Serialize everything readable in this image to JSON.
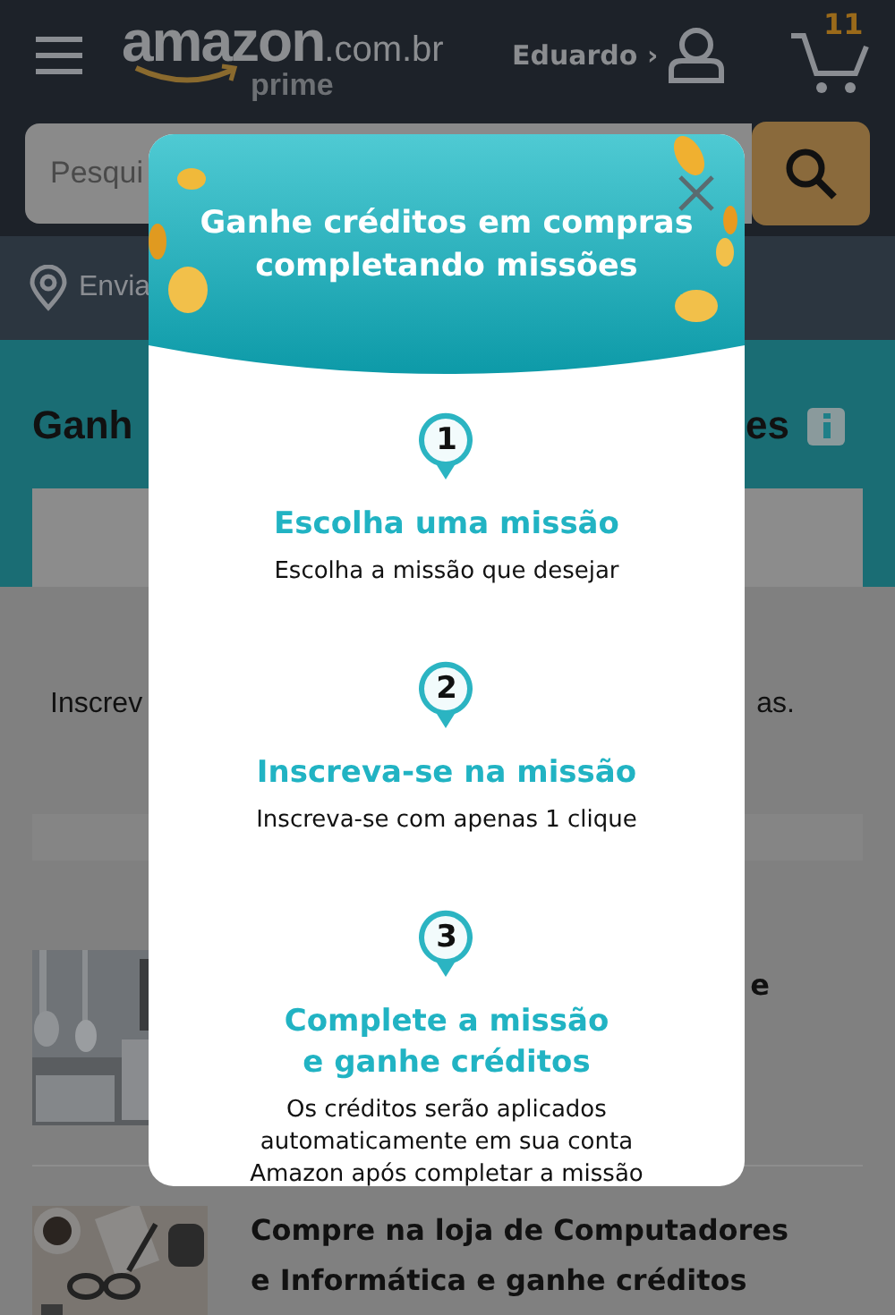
{
  "header": {
    "logo": "amazon",
    "domain": ".com.br",
    "tier": "prime",
    "account": "Eduardo ›",
    "cart_count": "11"
  },
  "search": {
    "placeholder": "Pesqui"
  },
  "location": {
    "label": "Envia"
  },
  "banner": {
    "title_start": "Ganh",
    "title_end": "es"
  },
  "intro": {
    "text_start": "Inscrev",
    "text_end": "as."
  },
  "products": [
    {
      "kind": "kitchen",
      "title": "e"
    },
    {
      "kind": "desk",
      "title": "Compre na loja de Computadores e Informática e ganhe créditos"
    }
  ],
  "modal": {
    "title": "Ganhe créditos em compras completando missões",
    "steps": [
      {
        "number": "1",
        "title": "Escolha uma missão",
        "description": "Escolha a missão que desejar"
      },
      {
        "number": "2",
        "title": "Inscreva-se na missão",
        "description": "Inscreva-se com apenas 1 clique"
      },
      {
        "number": "3",
        "title": "Complete a missão\ne ganhe créditos",
        "description": "Os créditos serão aplicados\nautomaticamente em sua conta\nAmazon após completar a missão"
      }
    ]
  }
}
